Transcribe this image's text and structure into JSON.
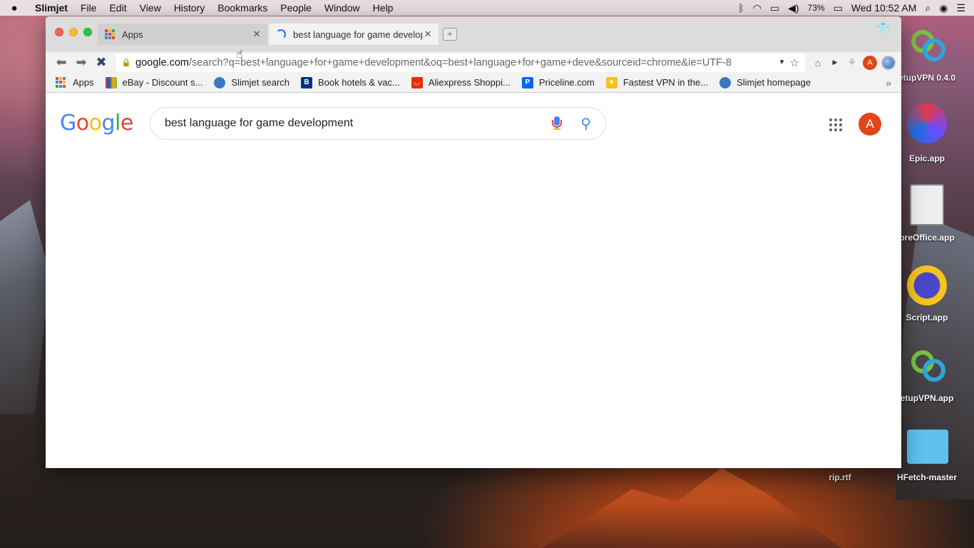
{
  "menubar": {
    "apple": "",
    "app_name": "Slimjet",
    "items": [
      "File",
      "Edit",
      "View",
      "History",
      "Bookmarks",
      "People",
      "Window",
      "Help"
    ],
    "battery": "73%",
    "clock": "Wed 10:52 AM",
    "icons": [
      "bluetooth-icon",
      "wifi-icon",
      "airplay-icon",
      "volume-icon",
      "battery-icon",
      "spotlight-icon",
      "siri-icon",
      "notification-center-icon"
    ]
  },
  "tabs": [
    {
      "title": "Apps",
      "active": false,
      "close": "✕"
    },
    {
      "title": "best language for game develop",
      "active": true,
      "close": "✕"
    }
  ],
  "toolbar": {
    "url_host": "google.com",
    "url_path": "/search?q=best+language+for+game+development&oq=best+language+for+game+deve&sourceid=chrome&ie=UTF-8",
    "profile_initial": "A"
  },
  "bookmarks": [
    {
      "label": "Apps",
      "icon": "apps-grid-icon"
    },
    {
      "label": "eBay - Discount s...",
      "icon": "ebay-icon",
      "color": "#e53238"
    },
    {
      "label": "Slimjet search",
      "icon": "globe-icon",
      "color": "#3b78c4"
    },
    {
      "label": "Book hotels & vac...",
      "icon": "booking-icon",
      "color": "#003580"
    },
    {
      "label": "Aliexpress Shoppi...",
      "icon": "aliexpress-icon",
      "color": "#e62e04"
    },
    {
      "label": "Priceline.com",
      "icon": "priceline-icon",
      "color": "#0068ef"
    },
    {
      "label": "Fastest VPN in the...",
      "icon": "vpn-icon",
      "color": "#f6c21a"
    },
    {
      "label": "Slimjet homepage",
      "icon": "globe-icon",
      "color": "#3b78c4"
    }
  ],
  "google": {
    "logo_letters": [
      {
        "ch": "G",
        "color": "#4285f4"
      },
      {
        "ch": "o",
        "color": "#ea4335"
      },
      {
        "ch": "o",
        "color": "#fbbc05"
      },
      {
        "ch": "g",
        "color": "#4285f4"
      },
      {
        "ch": "l",
        "color": "#34a853"
      },
      {
        "ch": "e",
        "color": "#ea4335"
      }
    ],
    "query": "best language for game development",
    "avatar_initial": "A"
  },
  "desktop_icons": [
    {
      "label": "etupVPN 0.4.0"
    },
    {
      "label": "Epic.app"
    },
    {
      "label": "breOffice.app"
    },
    {
      "label": "Script.app"
    },
    {
      "label": "etupVPN.app"
    },
    {
      "label": "HFetch-master"
    },
    {
      "label": "rip.rtf"
    }
  ]
}
